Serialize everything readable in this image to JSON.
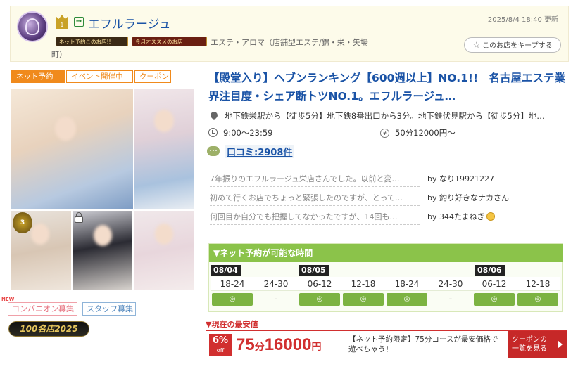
{
  "header": {
    "shop_name": "エフルラージュ",
    "rank_number": "1",
    "updated": "2025/8/4 18:40 更新",
    "badge_net_reserve": "ネット予約このお店!!",
    "badge_today": "今月オススメのお店",
    "category": "エステ・アロマ（店舗型エステ/錦・栄・矢場",
    "category_wrap": "町）",
    "keep_button": "このお店をキープする"
  },
  "tags": [
    "ネット予約",
    "イベント開催中",
    "クーポン"
  ],
  "photos": {
    "rank_badge_text": "3"
  },
  "recruit": {
    "new_mark": "NEW",
    "companion": "コンパニオン募集",
    "staff": "スタッフ募集",
    "shop100": "100名店2025"
  },
  "catch_copy": "【殿堂入り】ヘブンランキング【600週以上】NO.1!!　名古屋エステ業界注目度・シェア断トツNO.1。エフルラージュ…",
  "info": {
    "access": "地下鉄栄駅から【徒歩5分】地下鉄8番出口から3分。地下鉄伏見駅から【徒歩5分】地…",
    "hours": "9:00〜23:59",
    "price": "50分12000円〜",
    "yen_symbol": "¥"
  },
  "review_link": "口コミ:2908件",
  "reviews": [
    {
      "text": "7年振りのエフルラージュ栄店さんでした。以前と変…",
      "by": "by なり19921227"
    },
    {
      "text": "初めて行くお店でちょっと緊張したのですが、とって…",
      "by": "by 釣り好きなナカさん"
    },
    {
      "text": "何回目か自分でも把握してなかったですが、14回も…",
      "by": "by 344たまねぎ"
    }
  ],
  "reserve": {
    "title": "▼ネット予約が可能な時間",
    "dates": [
      "08/04",
      "08/05",
      "08/06"
    ],
    "slots": [
      {
        "time": "18-24",
        "mark": "◎",
        "ok": true
      },
      {
        "time": "24-30",
        "mark": "-",
        "ok": false
      },
      {
        "time": "06-12",
        "mark": "◎",
        "ok": true
      },
      {
        "time": "12-18",
        "mark": "◎",
        "ok": true
      },
      {
        "time": "18-24",
        "mark": "◎",
        "ok": true
      },
      {
        "time": "24-30",
        "mark": "-",
        "ok": false
      },
      {
        "time": "06-12",
        "mark": "◎",
        "ok": true
      },
      {
        "time": "12-18",
        "mark": "◎",
        "ok": true
      }
    ]
  },
  "lowest": {
    "label": "▼現在の最安値",
    "off_pct": "6%",
    "off_word": "off",
    "minutes": "75",
    "minutes_unit": "分",
    "price": "16000",
    "price_unit": "円",
    "note": "【ネット予約限定】75分コースが最安価格で遊べちゃう！",
    "coupon_button_line1": "クーポンの",
    "coupon_button_line2": "一覧を見る"
  },
  "colors": {
    "link_blue": "#1a53a6",
    "accent_orange": "#f08a1c",
    "reserve_green": "#8bc34a",
    "price_red": "#d12f2f"
  }
}
